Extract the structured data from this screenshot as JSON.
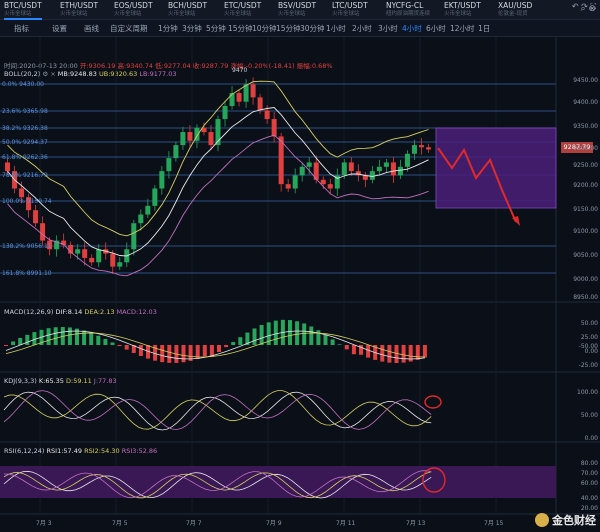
{
  "tabs": [
    {
      "pair": "BTC/USDT",
      "sub": "火币全球站",
      "active": true
    },
    {
      "pair": "ETH/USDT",
      "sub": "火币全球站"
    },
    {
      "pair": "EOS/USDT",
      "sub": "火币全球站"
    },
    {
      "pair": "BCH/USDT",
      "sub": "火币全球站"
    },
    {
      "pair": "ETC/USDT",
      "sub": "火币全球站"
    },
    {
      "pair": "BSV/USDT",
      "sub": "火币全球站"
    },
    {
      "pair": "LTC/USDT",
      "sub": "火币全球站"
    },
    {
      "pair": "NYCFG-CL",
      "sub": "纽约原油期货连续"
    },
    {
      "pair": "EKT/USDT",
      "sub": "火币全球站"
    },
    {
      "pair": "XAU/USD",
      "sub": "伦敦金-现货"
    }
  ],
  "toolbar": {
    "items": [
      "指标",
      "设置",
      "画线",
      "自定义周期",
      "1分钟",
      "3分钟",
      "5分钟",
      "15分钟",
      "10分钟",
      "15分钟",
      "30分钟",
      "1小时",
      "2小时",
      "3小时",
      "4小时",
      "6小时",
      "12小时",
      "1日"
    ],
    "active_index": 14
  },
  "ohlc": {
    "time": "时间:2020-07-13 20:00",
    "open": "开:9306.19",
    "high": "高:9340.74",
    "low": "低:9277.04",
    "close": "收:9287.79",
    "change": "涨幅:-0.20%(-18.41)",
    "amplitude": "振幅:0.68%"
  },
  "boll": {
    "label": "BOLL(20,2)",
    "mb": "MB:9248.83",
    "ub": "UB:9320.63",
    "lb": "LB:9177.03"
  },
  "peak_label": "9470",
  "price_axis": [
    "9450.00",
    "9400.00",
    "9350.00",
    "9300.00",
    "9250.00",
    "9200.00",
    "9150.00",
    "9100.00",
    "9050.00",
    "9000.00",
    "8950.00"
  ],
  "current_price": "9287.79",
  "fib": [
    "0.0% 9430.00",
    "23.6% 9365.98",
    "38.2% 9326.38",
    "50.0% 9294.37",
    "61.8% 9262.36",
    "78.6% 9216.79",
    "100.0% 9159.74",
    "138.2% 9056.11",
    "161.8% 8991.10"
  ],
  "macd": {
    "label": "MACD(12,26,9)",
    "dif": "DIF:8.14",
    "dea": "DEA:2.13",
    "macd": "MACD:12.03",
    "axis": [
      "50.00",
      "25.00",
      "0.00",
      "-25.00",
      "-50.00"
    ]
  },
  "kdj": {
    "label": "KDJ(9,3,3)",
    "k": "K:65.35",
    "d": "D:59.11",
    "j": "J:77.83",
    "axis": [
      "100.00",
      "50.00",
      "0.00"
    ]
  },
  "rsi": {
    "label": "RSI(6,12,24)",
    "r1": "RSI1:57.49",
    "r2": "RSI2:54.30",
    "r3": "RSI3:52.86",
    "axis": [
      "80.00",
      "70.00",
      "60.00",
      "40.00",
      "20.00"
    ]
  },
  "dates": [
    "7月 3",
    "7月 5",
    "7月 7",
    "7月 9",
    "7月 11",
    "7月 13",
    "7月 15"
  ],
  "watermark": "金色财经",
  "colors": {
    "up": "#26a65b",
    "down": "#e0403f",
    "accent": "#2a86ff",
    "boll_mid": "#e8e8e8",
    "boll_up": "#d8d060",
    "boll_low": "#c070c0"
  }
}
